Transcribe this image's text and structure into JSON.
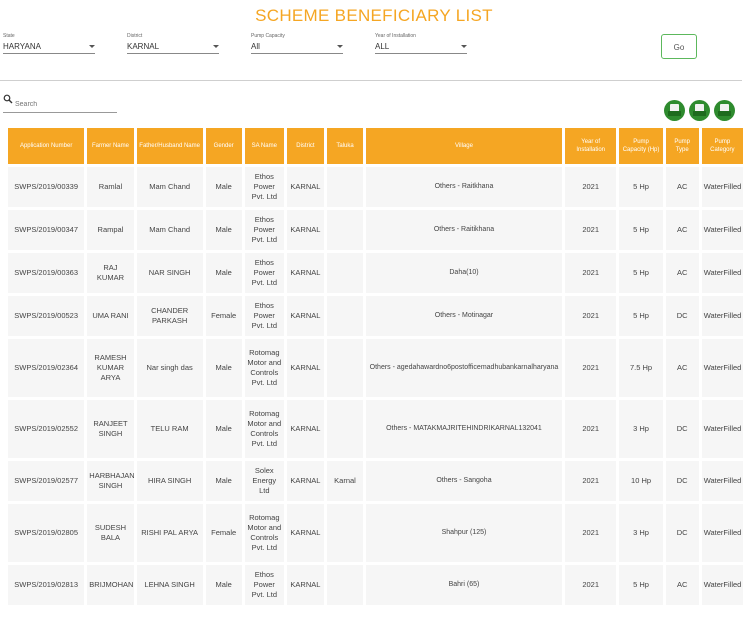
{
  "page": {
    "title": "SCHEME BENEFICIARY LIST",
    "accent_color": "#f5a623",
    "go_button_border": "#5cb85c",
    "export_icon_color": "#2e8b2e"
  },
  "filters": [
    {
      "label": "State",
      "value": "HARYANA"
    },
    {
      "label": "District",
      "value": "KARNAL"
    },
    {
      "label": "Pump Capacity",
      "value": "All"
    },
    {
      "label": "Year of Installation",
      "value": "ALL"
    }
  ],
  "go_label": "Go",
  "search": {
    "placeholder": "Search",
    "value": "",
    "icon": "search-icon"
  },
  "export_icons": [
    "csv-export-icon",
    "xls-export-icon",
    "pdf-export-icon"
  ],
  "table": {
    "columns": [
      "Application Number",
      "Farmer Name",
      "Father/Husband Name",
      "Gender",
      "SA Name",
      "District",
      "Taluka",
      "Village",
      "Year of Installation",
      "Pump Capacity (Hp)",
      "Pump Type",
      "Pump Category"
    ],
    "rows": [
      [
        "SWPS/2019/00339",
        "Ramlal",
        "Mam Chand",
        "Male",
        "Ethos Power Pvt. Ltd",
        "KARNAL",
        "",
        "Others - Raitkhana",
        "2021",
        "5 Hp",
        "AC",
        "WaterFilled"
      ],
      [
        "SWPS/2019/00347",
        "Rampal",
        "Mam Chand",
        "Male",
        "Ethos Power Pvt. Ltd",
        "KARNAL",
        "",
        "Others - Raitikhana",
        "2021",
        "5 Hp",
        "AC",
        "WaterFilled"
      ],
      [
        "SWPS/2019/00363",
        "RAJ KUMAR",
        "NAR SINGH",
        "Male",
        "Ethos Power Pvt. Ltd",
        "KARNAL",
        "",
        "Daha(10)",
        "2021",
        "5 Hp",
        "AC",
        "WaterFilled"
      ],
      [
        "SWPS/2019/00523",
        "UMA RANI",
        "CHANDER PARKASH",
        "Female",
        "Ethos Power Pvt. Ltd",
        "KARNAL",
        "",
        "Others - Motinagar",
        "2021",
        "5 Hp",
        "DC",
        "WaterFilled"
      ],
      [
        "SWPS/2019/02364",
        "RAMESH KUMAR ARYA",
        "Nar singh das",
        "Male",
        "Rotomag Motor and Controls Pvt. Ltd",
        "KARNAL",
        "",
        "Others - agedahawardno6postofficemadhubankarnalharyana",
        "2021",
        "7.5 Hp",
        "AC",
        "WaterFilled"
      ],
      [
        "SWPS/2019/02552",
        "RANJEET SINGH",
        "TELU RAM",
        "Male",
        "Rotomag Motor and Controls Pvt. Ltd",
        "KARNAL",
        "",
        "Others - MATAKMAJRITEHINDRIKARNAL132041",
        "2021",
        "3 Hp",
        "DC",
        "WaterFilled"
      ],
      [
        "SWPS/2019/02577",
        "HARBHAJAN SINGH",
        "HIRA SINGH",
        "Male",
        "Solex Energy Ltd",
        "KARNAL",
        "Karnal",
        "Others - Sangoha",
        "2021",
        "10 Hp",
        "DC",
        "WaterFilled"
      ],
      [
        "SWPS/2019/02805",
        "SUDESH BALA",
        "RISHI PAL ARYA",
        "Female",
        "Rotomag Motor and Controls Pvt. Ltd",
        "KARNAL",
        "",
        "Shahpur (125)",
        "2021",
        "3 Hp",
        "DC",
        "WaterFilled"
      ],
      [
        "SWPS/2019/02813",
        "BRIJMOHAN",
        "LEHNA SINGH",
        "Male",
        "Ethos Power Pvt. Ltd",
        "KARNAL",
        "",
        "Bahri (65)",
        "2021",
        "5 Hp",
        "AC",
        "WaterFilled"
      ]
    ]
  }
}
